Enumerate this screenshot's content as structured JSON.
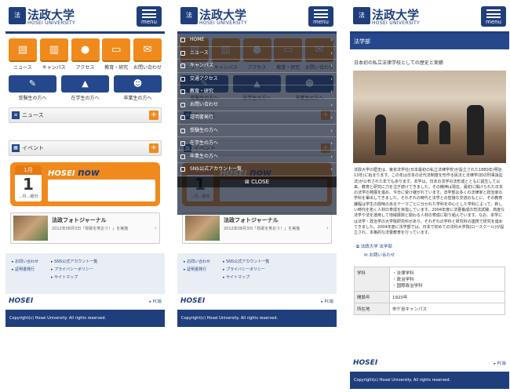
{
  "brand": {
    "name": "法政大学",
    "sub": "HOSEI UNIVERSITY",
    "menu_label": "menu"
  },
  "quick_links": [
    "ニュース",
    "キャンパス",
    "アクセス",
    "教育・研究",
    "お問い合わせ"
  ],
  "audience_links": [
    "受験生の方へ",
    "在学生の方へ",
    "卒業生の方へ"
  ],
  "sections": {
    "news": "ニュース",
    "event": "イベント"
  },
  "hosei_now": {
    "month": "1月",
    "day": "1",
    "weekday": "…月…曜日",
    "label_1": "HOSEI",
    "label_2": "now"
  },
  "journal": {
    "title": "法政フォトジャーナル",
    "desc": "2012年08月3日「校歌を笑おう！」を実施"
  },
  "footer_links": {
    "col1": [
      "お問い合わせ",
      "証明書発行",
      ""
    ],
    "col2": [
      "SNS公式アカウント一覧",
      "プライバシーポリシー",
      "サイトマップ"
    ]
  },
  "footer_brand": "HOSEI",
  "pc_link": "PC版",
  "copyright": "Copyright(c) Hosei University. All rights reserved.",
  "menu_overlay": {
    "items": [
      "HOME",
      "ニュース",
      "キャンパス",
      "交通アクセス",
      "教育・研究",
      "お問い合わせ",
      "証明書発行",
      "受験生の方へ",
      "在学生の方へ",
      "卒業生の方へ",
      "SNS公式アカウント一覧"
    ],
    "close_label": "CLOSE"
  },
  "detail": {
    "title": "法学部",
    "heading": "日本初の私立法律学校としての歴史と実績",
    "body": "法政大学の歴史は、東京法学社(日本最初の私立法律学校)が設立された1880年(明治13年)に始まります。この年は日本の近代法制度を形作る民法と法律学(旧の刑事訴訟法)が公布された年でもあります。本学は、日本の法学の法形成とともに誕生して以来、教育と研究に力を注ぎ続けてきました。その精神は現在、最初に掲げられた日本の法学の発展を進め、今日に受け継がれています。法学部は多くの法律家と政治家の学科を輩出してきました。それぞれの時代と法学との密接な交流のもとに、その教育課程は学生の興味のあるテーマごとに分かれた学科を中心とした学科によって、新しい時代を拓く人材の育成を目指しています。2004年度に法曹養成の司法試験、高度な法学や法を運用して地域振興と関わる人材の育成に取り組んでいます。なお、本学には法学・政治学の大学院研究科があり、それぞれの学科と研究科の連携で研究を進めてきました。2004年度に法学部では、日本で初めての法科大学院(ロースクール)が設立され、本格的な法曹教育を行っています。",
    "links": [
      "法政大学 法学部",
      "お問い合わせ"
    ],
    "table": [
      {
        "k": "学科",
        "v": [
          "法律学科",
          "政治学科",
          "国際政治学科"
        ]
      },
      {
        "k": "開設年",
        "v": [
          "1920年"
        ]
      },
      {
        "k": "所在地",
        "v": [
          "市ケ谷キャンパス"
        ]
      }
    ]
  }
}
